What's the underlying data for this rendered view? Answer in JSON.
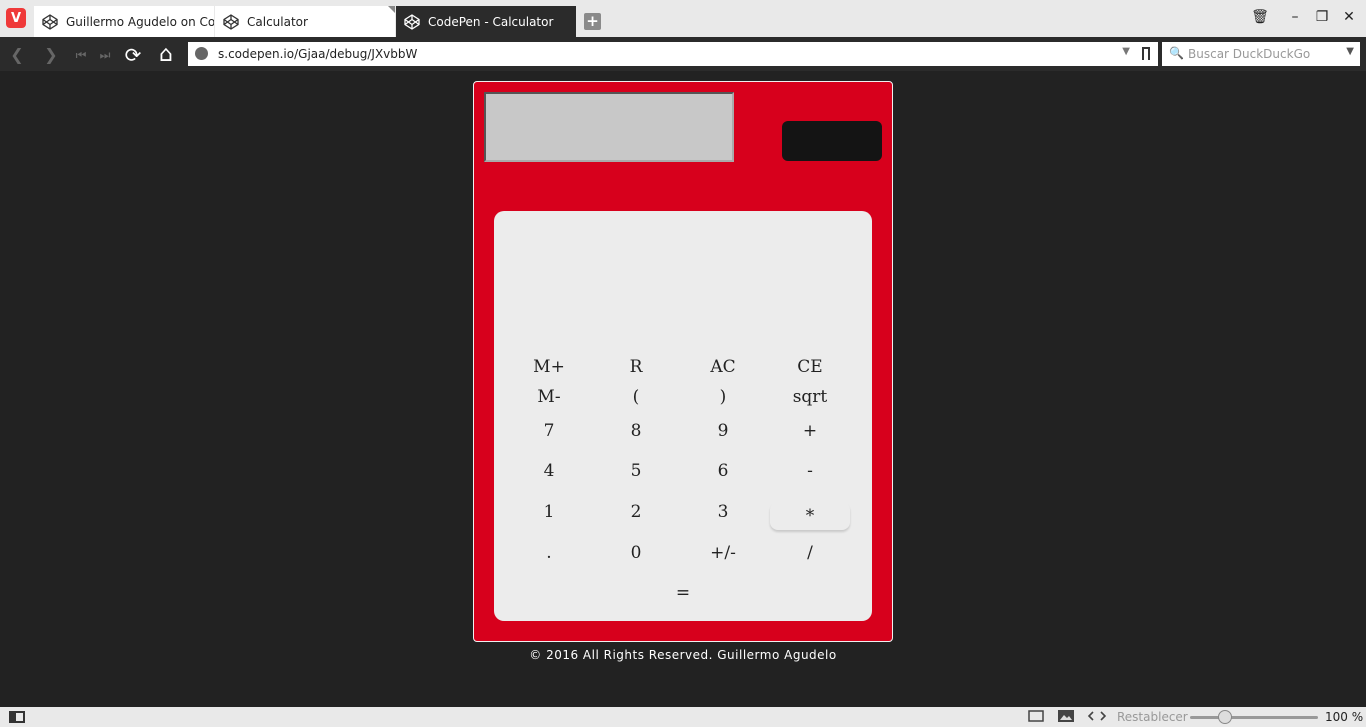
{
  "browser": {
    "logo": "V",
    "tabs": [
      {
        "title": "Guillermo Agudelo on Co",
        "icon": "codepen-icon",
        "active": false
      },
      {
        "title": "Calculator",
        "icon": "codepen-icon",
        "active": false
      },
      {
        "title": "CodePen - Calculator",
        "icon": "codepen-icon",
        "active": true
      }
    ],
    "new_tab": "+",
    "window": {
      "trash": "🗑",
      "minimize": "–",
      "restore": "❐",
      "close": "✕"
    },
    "nav": {
      "back": "❮",
      "forward": "❯",
      "first": "⏮",
      "last": "⏭",
      "reload": "⟳",
      "home": "⌂"
    },
    "url": "s.codepen.io/Gjaa/debug/JXvbbW",
    "url_dropdown": "▼",
    "search_placeholder": "Buscar DuckDuckGo",
    "search_icon": "🔍",
    "search_dropdown": "▼"
  },
  "calculator": {
    "accent_color": "#d7001c",
    "display_value": "",
    "keys": [
      [
        "M+",
        "R",
        "AC",
        "CE"
      ],
      [
        "M-",
        "(",
        ")",
        "sqrt"
      ],
      [
        "7",
        "8",
        "9",
        "+"
      ],
      [
        "4",
        "5",
        "6",
        "-"
      ],
      [
        "1",
        "2",
        "3",
        "*"
      ],
      [
        ".",
        "0",
        "+/-",
        "/"
      ],
      [
        "="
      ]
    ]
  },
  "footer": {
    "copyright": "© 2016 All Rights Reserved. Guillermo Agudelo"
  },
  "statusbar": {
    "reset": "Restablecer",
    "zoom": "100 %",
    "zoom_level": 1.0
  }
}
